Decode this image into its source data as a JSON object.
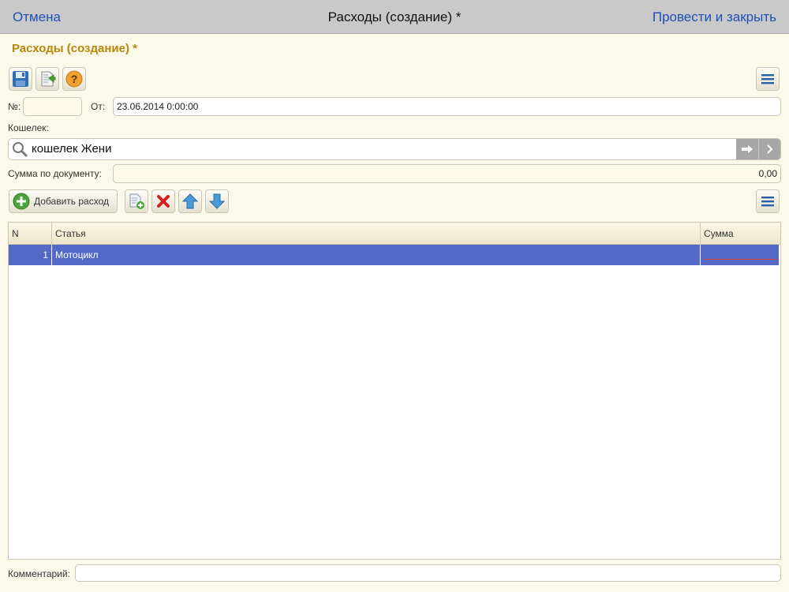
{
  "navbar": {
    "cancel_label": "Отмена",
    "title": "Расходы (создание) *",
    "post_close_label": "Провести и закрыть"
  },
  "form": {
    "title": "Расходы (создание) *"
  },
  "toolbar": {
    "save_icon": "save-icon",
    "post_icon": "post-document-icon",
    "help_icon": "help-icon",
    "menu_icon": "menu-icon"
  },
  "header_fields": {
    "number_label": "№:",
    "number_value": "",
    "date_label": "От:",
    "date_value": "23.06.2014  0:00:00"
  },
  "wallet": {
    "label": "Кошелек:",
    "value": "кошелек Жени"
  },
  "total": {
    "label": "Сумма по документу:",
    "value": "0,00"
  },
  "table_toolbar": {
    "add_label": "Добавить расход"
  },
  "table": {
    "columns": [
      "N",
      "Статья",
      "Сумма"
    ],
    "rows": [
      {
        "n": "1",
        "item": "Мотоцикл",
        "amount": ""
      }
    ]
  },
  "comment": {
    "label": "Комментарий:",
    "value": ""
  },
  "colors": {
    "accent": "#1f4fb8",
    "title": "#b8860b",
    "selection": "#5469c5"
  }
}
